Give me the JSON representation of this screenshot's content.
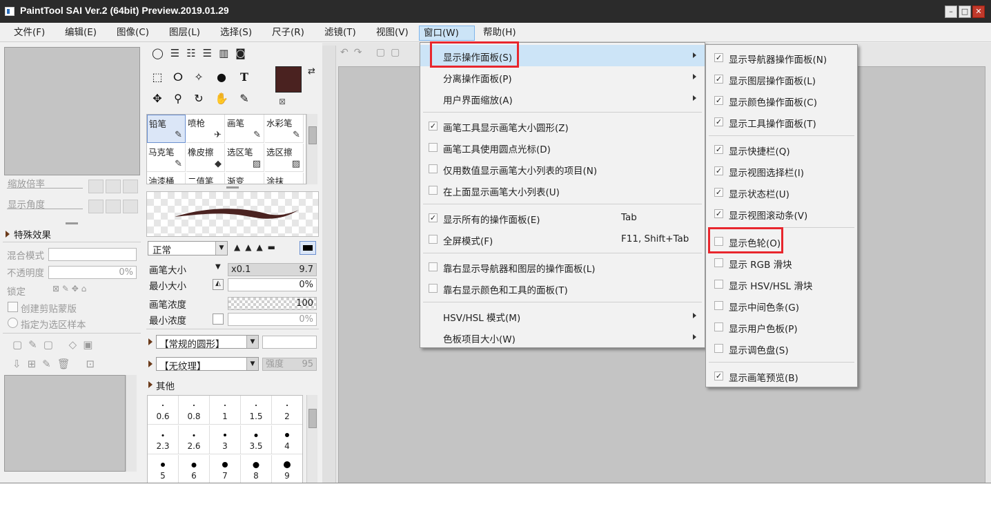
{
  "window": {
    "title": "PaintTool SAI Ver.2 (64bit) Preview.2019.01.29",
    "min": "–",
    "max": "□",
    "close": "✕"
  },
  "menubar": [
    "文件(F)",
    "编辑(E)",
    "图像(C)",
    "图层(L)",
    "选择(S)",
    "尺子(R)",
    "滤镜(T)",
    "视图(V)",
    "窗口(W)",
    "帮助(H)"
  ],
  "navigator": {
    "zoom_label": "缩放倍率",
    "angle_label": "显示角度"
  },
  "layer_panel": {
    "effects_label": "特殊效果",
    "blend_label": "混合模式",
    "opacity_label": "不透明度",
    "opacity_value": "0%",
    "lock_label": "锁定",
    "clip_label": "创建剪贴蒙版",
    "sample_label": "指定为选区样本"
  },
  "colors": {
    "primary": "#4a2220",
    "highlight_red": "#e8262d",
    "menu_highlight": "#cce4f7"
  },
  "brush_grid": [
    [
      "铅笔",
      "喷枪",
      "画笔",
      "水彩笔"
    ],
    [
      "马克笔",
      "橡皮擦",
      "选区笔",
      "选区擦"
    ],
    [
      "油漆桶",
      "二值笔",
      "渐变",
      "涂抹"
    ]
  ],
  "brush_settings": {
    "mode": "正常",
    "size_label": "画笔大小",
    "size_mult": "x0.1",
    "size_value": "9.7",
    "min_size_label": "最小大小",
    "min_size_value": "0%",
    "density_label": "画笔浓度",
    "density_value": "100",
    "min_density_label": "最小浓度",
    "min_density_value": "0%",
    "shape": "【常规的圆形】",
    "texture": "【无纹理】",
    "strength_label": "强度",
    "strength_value": "95",
    "other_label": "其他"
  },
  "dot_sizes": [
    "0.6",
    "0.8",
    "1",
    "1.5",
    "2",
    "2.3",
    "2.6",
    "3",
    "3.5",
    "4",
    "5",
    "6",
    "7",
    "8",
    "9"
  ],
  "window_menu": [
    {
      "label": "显示操作面板(S)",
      "submenu": true,
      "highlight": true
    },
    {
      "label": "分离操作面板(P)",
      "submenu": true
    },
    {
      "label": "用户界面缩放(A)",
      "submenu": true
    },
    {
      "sep": true
    },
    {
      "label": "画笔工具显示画笔大小圆形(Z)",
      "checked": true
    },
    {
      "label": "画笔工具使用圆点光标(D)",
      "checked": false
    },
    {
      "label": "仅用数值显示画笔大小列表的项目(N)",
      "checked": false
    },
    {
      "label": "在上面显示画笔大小列表(U)",
      "checked": false
    },
    {
      "sep": true
    },
    {
      "label": "显示所有的操作面板(E)",
      "checked": true,
      "shortcut": "Tab"
    },
    {
      "label": "全屏模式(F)",
      "checked": false,
      "shortcut": "F11, Shift+Tab"
    },
    {
      "sep": true
    },
    {
      "label": "靠右显示导航器和图层的操作面板(L)",
      "checked": false
    },
    {
      "label": "靠右显示颜色和工具的面板(T)",
      "checked": false
    },
    {
      "sep": true
    },
    {
      "label": "HSV/HSL 模式(M)",
      "submenu": true
    },
    {
      "label": "色板项目大小(W)",
      "submenu": true
    }
  ],
  "panel_submenu": [
    {
      "label": "显示导航器操作面板(N)",
      "checked": true
    },
    {
      "label": "显示图层操作面板(L)",
      "checked": true
    },
    {
      "label": "显示颜色操作面板(C)",
      "checked": true
    },
    {
      "label": "显示工具操作面板(T)",
      "checked": true
    },
    {
      "sep": true
    },
    {
      "label": "显示快捷栏(Q)",
      "checked": true
    },
    {
      "label": "显示视图选择栏(I)",
      "checked": true
    },
    {
      "label": "显示状态栏(U)",
      "checked": true
    },
    {
      "label": "显示视图滚动条(V)",
      "checked": true
    },
    {
      "sep": true
    },
    {
      "label": "显示色轮(O)",
      "checked": false
    },
    {
      "label": "显示 RGB 滑块",
      "checked": false
    },
    {
      "label": "显示 HSV/HSL 滑块",
      "checked": false
    },
    {
      "label": "显示中间色条(G)",
      "checked": false
    },
    {
      "label": "显示用户色板(P)",
      "checked": false
    },
    {
      "label": "显示调色盘(S)",
      "checked": false
    },
    {
      "sep": true
    },
    {
      "label": "显示画笔预览(B)",
      "checked": true
    }
  ]
}
